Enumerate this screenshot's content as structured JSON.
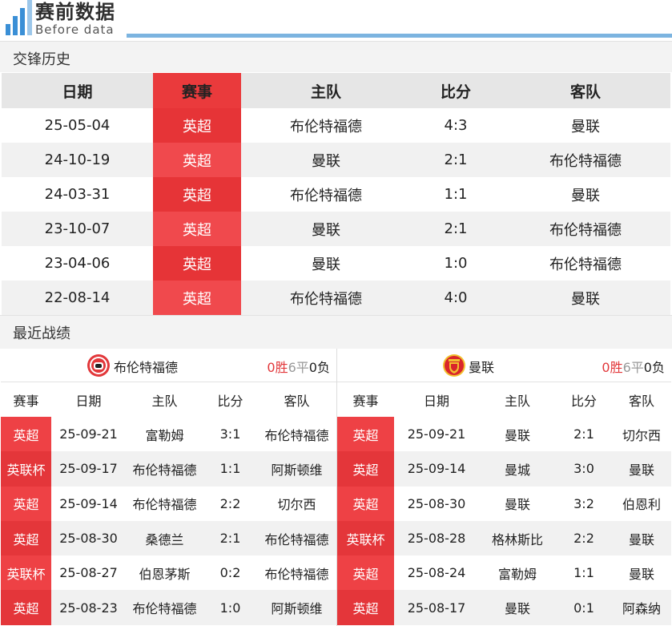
{
  "header": {
    "title": "赛前数据",
    "subtitle": "Before data",
    "accent_color": "#3a8fd6"
  },
  "h2h": {
    "section_title": "交锋历史",
    "columns": [
      "日期",
      "赛事",
      "主队",
      "比分",
      "客队"
    ],
    "rows": [
      {
        "date": "25-05-04",
        "comp": "英超",
        "home": "布伦特福德",
        "score": "4:3",
        "away": "曼联"
      },
      {
        "date": "24-10-19",
        "comp": "英超",
        "home": "曼联",
        "score": "2:1",
        "away": "布伦特福德"
      },
      {
        "date": "24-03-31",
        "comp": "英超",
        "home": "布伦特福德",
        "score": "1:1",
        "away": "曼联"
      },
      {
        "date": "23-10-07",
        "comp": "英超",
        "home": "曼联",
        "score": "2:1",
        "away": "布伦特福德"
      },
      {
        "date": "23-04-06",
        "comp": "英超",
        "home": "曼联",
        "score": "1:0",
        "away": "布伦特福德"
      },
      {
        "date": "22-08-14",
        "comp": "英超",
        "home": "布伦特福德",
        "score": "4:0",
        "away": "曼联"
      }
    ]
  },
  "recent": {
    "section_title": "最近战绩",
    "columns": [
      "赛事",
      "日期",
      "主队",
      "比分",
      "客队"
    ],
    "left": {
      "team": "布伦特福德",
      "logo_icon": "brentford-crest-icon",
      "wins": "0",
      "win_label": "胜",
      "draws": "6",
      "draw_label": "平",
      "losses": "0",
      "loss_label": "负",
      "rows": [
        {
          "comp": "英超",
          "date": "25-09-21",
          "home": "富勒姆",
          "score": "3:1",
          "away": "布伦特福德"
        },
        {
          "comp": "英联杯",
          "date": "25-09-17",
          "home": "布伦特福德",
          "score": "1:1",
          "away": "阿斯顿维"
        },
        {
          "comp": "英超",
          "date": "25-09-14",
          "home": "布伦特福德",
          "score": "2:2",
          "away": "切尔西"
        },
        {
          "comp": "英超",
          "date": "25-08-30",
          "home": "桑德兰",
          "score": "2:1",
          "away": "布伦特福德"
        },
        {
          "comp": "英联杯",
          "date": "25-08-27",
          "home": "伯恩茅斯",
          "score": "0:2",
          "away": "布伦特福德"
        },
        {
          "comp": "英超",
          "date": "25-08-23",
          "home": "布伦特福德",
          "score": "1:0",
          "away": "阿斯顿维"
        }
      ]
    },
    "right": {
      "team": "曼联",
      "logo_icon": "manutd-crest-icon",
      "wins": "0",
      "win_label": "胜",
      "draws": "6",
      "draw_label": "平",
      "losses": "0",
      "loss_label": "负",
      "rows": [
        {
          "comp": "英超",
          "date": "25-09-21",
          "home": "曼联",
          "score": "2:1",
          "away": "切尔西"
        },
        {
          "comp": "英超",
          "date": "25-09-14",
          "home": "曼城",
          "score": "3:0",
          "away": "曼联"
        },
        {
          "comp": "英超",
          "date": "25-08-30",
          "home": "曼联",
          "score": "3:2",
          "away": "伯恩利"
        },
        {
          "comp": "英联杯",
          "date": "25-08-28",
          "home": "格林斯比",
          "score": "2:2",
          "away": "曼联"
        },
        {
          "comp": "英超",
          "date": "25-08-24",
          "home": "富勒姆",
          "score": "1:1",
          "away": "曼联"
        },
        {
          "comp": "英超",
          "date": "25-08-17",
          "home": "曼联",
          "score": "0:1",
          "away": "阿森纳"
        }
      ]
    }
  }
}
